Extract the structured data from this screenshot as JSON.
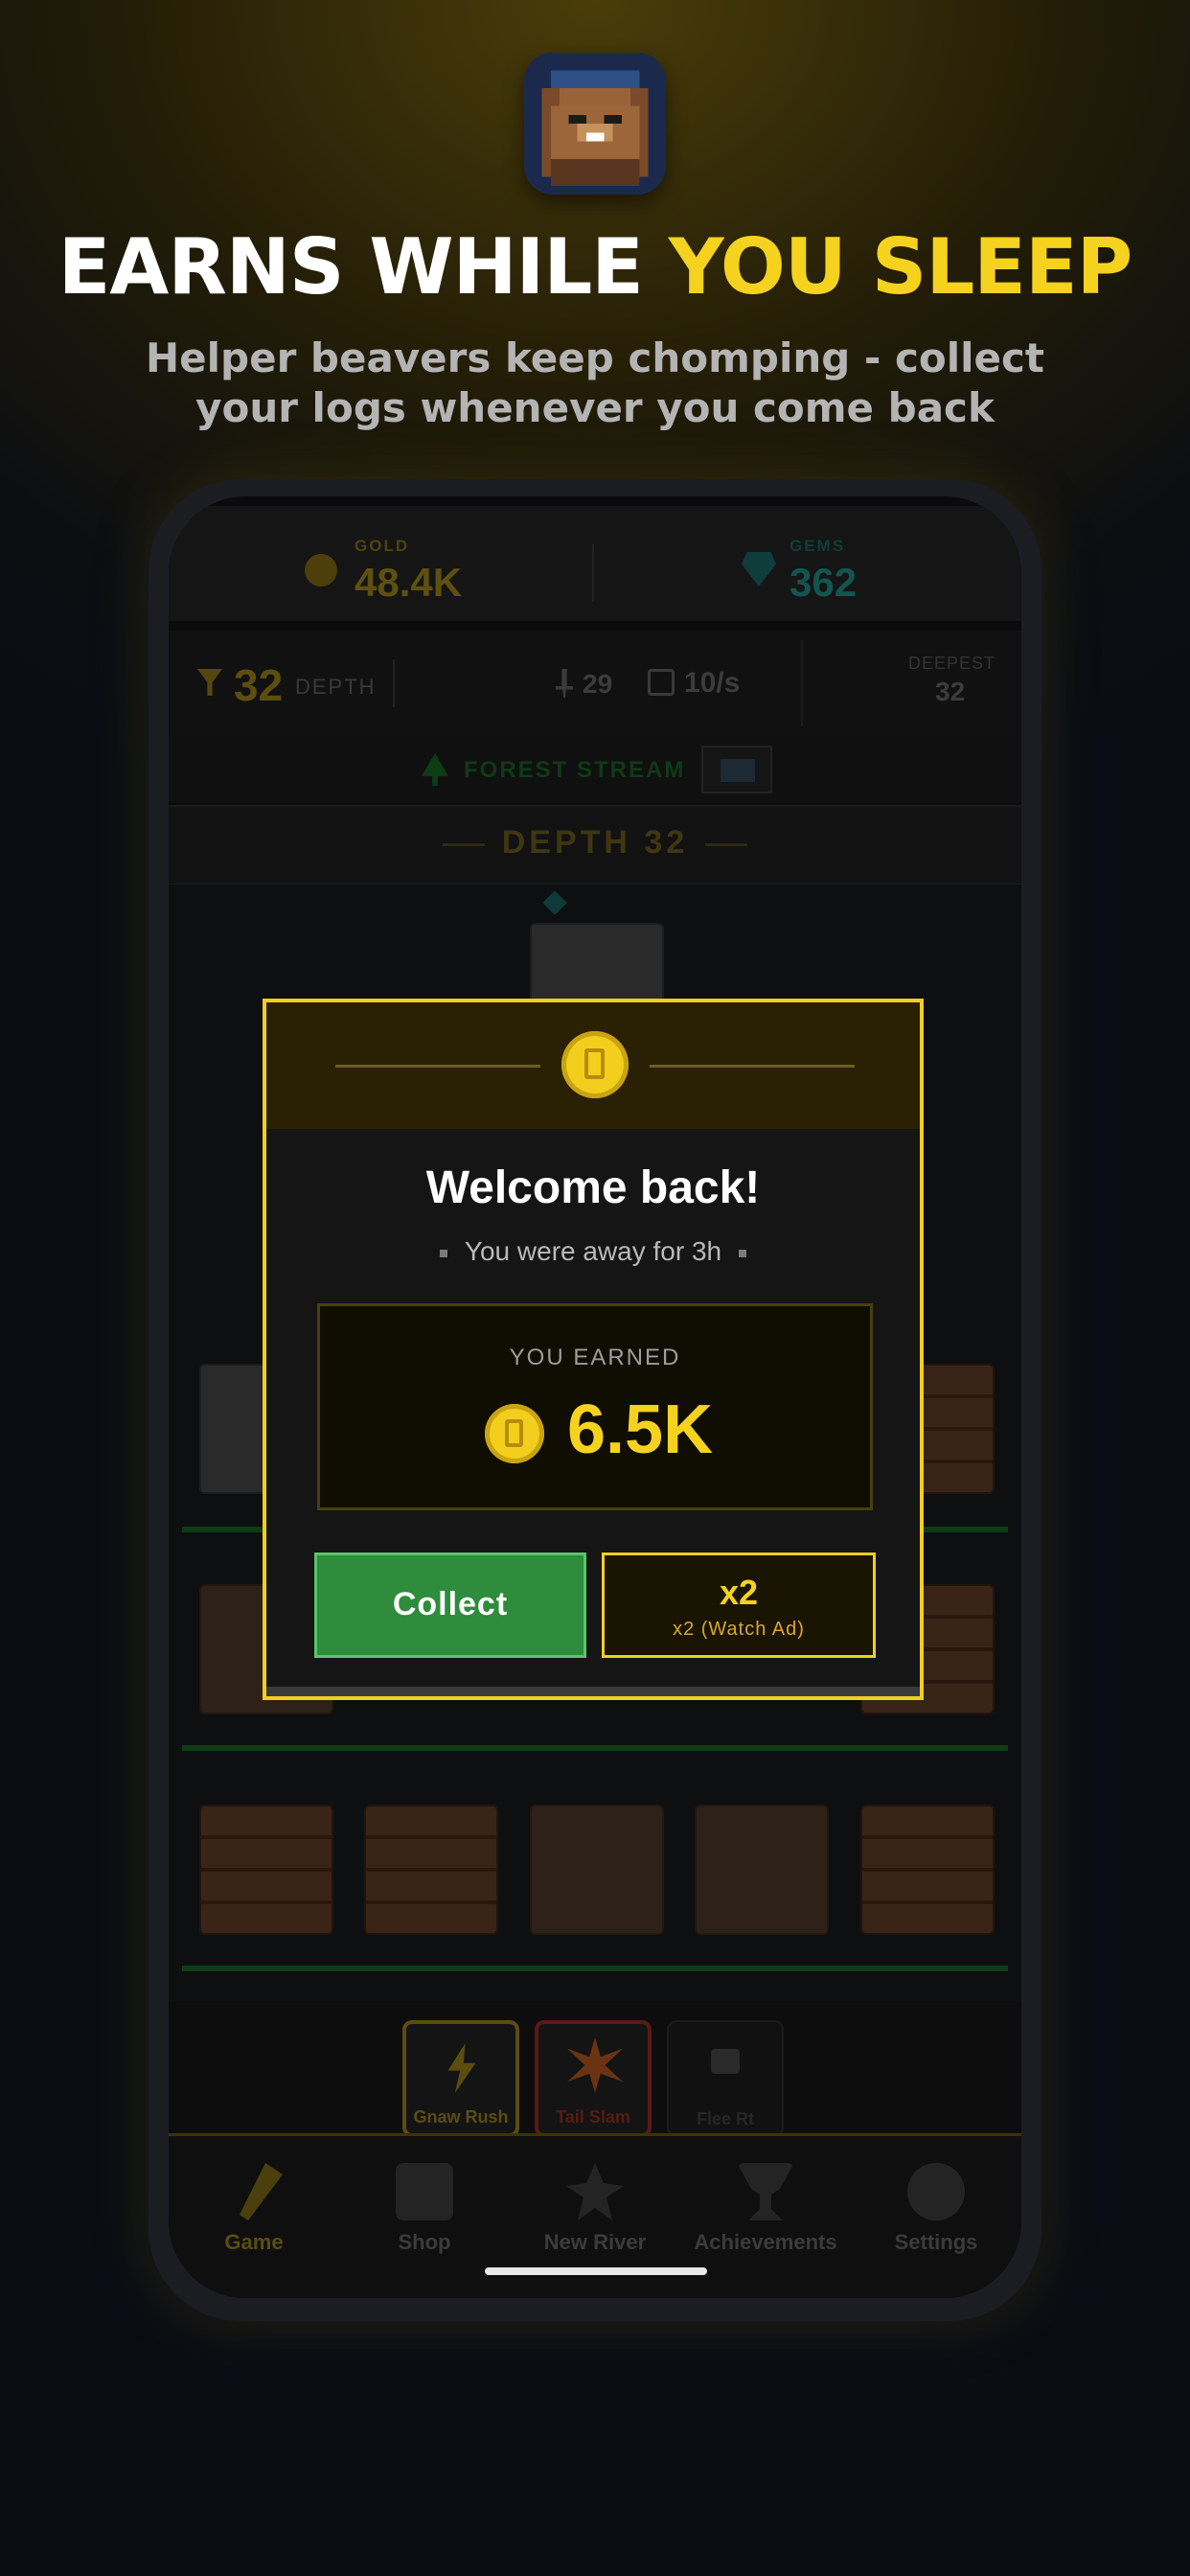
{
  "promo": {
    "headline_white": "EARNS WHILE",
    "headline_yellow": "YOU SLEEP",
    "subline": "Helper beavers keep chomping - collect your logs whenever you come back"
  },
  "hud": {
    "gold_label": "GOLD",
    "gold_value": "48.4K",
    "gems_label": "GEMS",
    "gems_value": "362",
    "depth_value": "32",
    "depth_label": "DEPTH",
    "helpers": "29",
    "rate": "10/s",
    "deepest_label": "DEEPEST",
    "deepest_value": "32",
    "zone_name": "FOREST STREAM",
    "depth_banner": "DEPTH 32"
  },
  "abilities": [
    {
      "label": "Gnaw Rush"
    },
    {
      "label": "Tail Slam"
    },
    {
      "label": "Flee Rt"
    }
  ],
  "nav": [
    {
      "label": "Game"
    },
    {
      "label": "Shop"
    },
    {
      "label": "New River"
    },
    {
      "label": "Achievements"
    },
    {
      "label": "Settings"
    }
  ],
  "modal": {
    "title": "Welcome back!",
    "away_text": "You were away for 3h",
    "earned_label": "YOU EARNED",
    "earned_value": "6.5K",
    "collect_label": "Collect",
    "x2_label": "x2",
    "x2_sub": "x2 (Watch Ad)"
  },
  "colors": {
    "accent_gold": "#f5d21e",
    "collect_green": "#2e8c3c",
    "gem_teal": "#1fa6a0"
  }
}
